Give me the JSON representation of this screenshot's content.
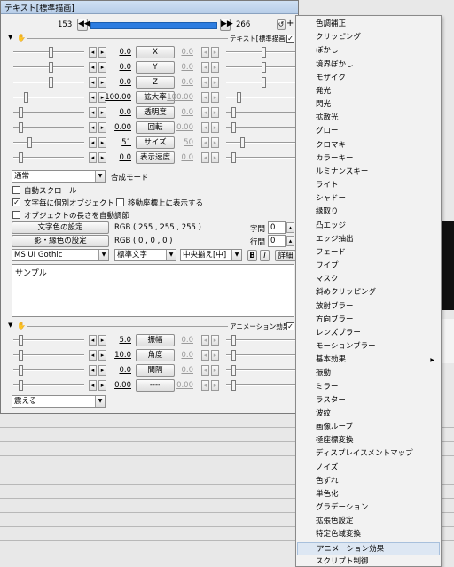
{
  "window": {
    "title": "テキスト[標準描画]",
    "frame_start": "153",
    "frame_end": "266",
    "header_label": "テキスト[標準描画]",
    "anim_header_label": "アニメーション効果"
  },
  "params": [
    {
      "value": "0.0",
      "label": "X",
      "right": "0.0"
    },
    {
      "value": "0.0",
      "label": "Y",
      "right": "0.0"
    },
    {
      "value": "0.0",
      "label": "Z",
      "right": "0.0"
    },
    {
      "value": "100.00",
      "label": "拡大率",
      "right": "100.00"
    },
    {
      "value": "0.0",
      "label": "透明度",
      "right": "0.0"
    },
    {
      "value": "0.00",
      "label": "回転",
      "right": "0.00"
    },
    {
      "value": "51",
      "label": "サイズ",
      "right": "50"
    },
    {
      "value": "0.0",
      "label": "表示速度",
      "right": "0.0"
    }
  ],
  "blend": {
    "value": "通常",
    "label": "合成モード"
  },
  "checks": {
    "auto_scroll": "自動スクロール",
    "per_char": "文字毎に個別オブジェクト",
    "on_coord": "移動座標上に表示する",
    "auto_length": "オブジェクトの長さを自動調節"
  },
  "colors": {
    "text_btn": "文字色の設定",
    "text_rgb": "RGB ( 255 , 255 , 255 )",
    "shadow_btn": "影・縁色の設定",
    "shadow_rgb": "RGB ( 0 , 0 , 0 )",
    "char_spacing_label": "字間",
    "char_spacing": "0",
    "line_spacing_label": "行間",
    "line_spacing": "0"
  },
  "font": {
    "family": "MS UI Gothic",
    "style": "標準文字",
    "align": "中央揃え[中]",
    "bold": "B",
    "italic": "I",
    "detail": "詳細"
  },
  "textarea": {
    "content": "サンプル"
  },
  "anim_params": [
    {
      "value": "5.0",
      "label": "振幅",
      "right": "0.0"
    },
    {
      "value": "10.0",
      "label": "角度",
      "right": "0.0"
    },
    {
      "value": "0.0",
      "label": "間隔",
      "right": "0.0"
    },
    {
      "value": "0.00",
      "label": "----",
      "right": "0.00"
    }
  ],
  "anim_type": {
    "value": "震える"
  },
  "menu_items": [
    "色調補正",
    "クリッピング",
    "ぼかし",
    "境界ぼかし",
    "モザイク",
    "発光",
    "閃光",
    "拡散光",
    "グロー",
    "クロマキー",
    "カラーキー",
    "ルミナンスキー",
    "ライト",
    "シャドー",
    "縁取り",
    "凸エッジ",
    "エッジ抽出",
    "フェード",
    "ワイプ",
    "マスク",
    "斜めクリッピング",
    "放射ブラー",
    "方向ブラー",
    "レンズブラー",
    "モーションブラー",
    "基本効果",
    "振動",
    "ミラー",
    "ラスター",
    "波紋",
    "画像ループ",
    "極座標変換",
    "ディスプレイスメントマップ",
    "ノイズ",
    "色ずれ",
    "単色化",
    "グラデーション",
    "拡張色設定",
    "特定色域変換",
    "アニメーション効果",
    "スクリプト制御"
  ],
  "menu_submenu_index": 25,
  "menu_highlight_index": 39
}
